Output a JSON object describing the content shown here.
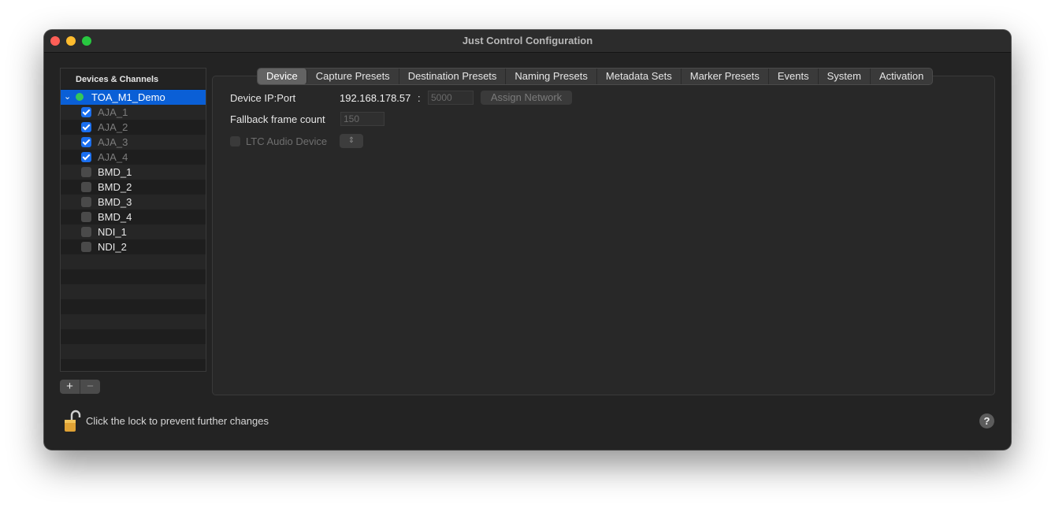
{
  "window": {
    "title": "Just Control Configuration"
  },
  "sidebar": {
    "header": "Devices & Channels",
    "device": {
      "label": "TOA_M1_Demo",
      "status_color": "#34c759",
      "expanded": true
    },
    "channels": [
      {
        "label": "AJA_1",
        "checked": true,
        "dimmed": true
      },
      {
        "label": "AJA_2",
        "checked": true,
        "dimmed": true
      },
      {
        "label": "AJA_3",
        "checked": true,
        "dimmed": true
      },
      {
        "label": "AJA_4",
        "checked": true,
        "dimmed": true
      },
      {
        "label": "BMD_1",
        "checked": false,
        "dimmed": false
      },
      {
        "label": "BMD_2",
        "checked": false,
        "dimmed": false
      },
      {
        "label": "BMD_3",
        "checked": false,
        "dimmed": false
      },
      {
        "label": "BMD_4",
        "checked": false,
        "dimmed": false
      },
      {
        "label": "NDI_1",
        "checked": false,
        "dimmed": false
      },
      {
        "label": "NDI_2",
        "checked": false,
        "dimmed": false
      }
    ],
    "add_label": "+",
    "remove_label": "−"
  },
  "tabs": [
    {
      "label": "Device",
      "active": true
    },
    {
      "label": "Capture Presets",
      "active": false
    },
    {
      "label": "Destination Presets",
      "active": false
    },
    {
      "label": "Naming Presets",
      "active": false
    },
    {
      "label": "Metadata Sets",
      "active": false
    },
    {
      "label": "Marker Presets",
      "active": false
    },
    {
      "label": "Events",
      "active": false
    },
    {
      "label": "System",
      "active": false
    },
    {
      "label": "Activation",
      "active": false
    }
  ],
  "device_tab": {
    "ip_port_label": "Device IP:Port",
    "ip_value": "192.168.178.57",
    "separator": ":",
    "port_placeholder": "5000",
    "assign_network_label": "Assign Network",
    "fallback_label": "Fallback frame count",
    "fallback_placeholder": "150",
    "ltc_label": "LTC Audio Device",
    "ltc_checked": false,
    "ltc_popup_icon": "updown-chevron-icon"
  },
  "footer": {
    "lock_text": "Click the lock to prevent further changes",
    "lock_icon": "unlocked-padlock-icon",
    "help_label": "?"
  }
}
